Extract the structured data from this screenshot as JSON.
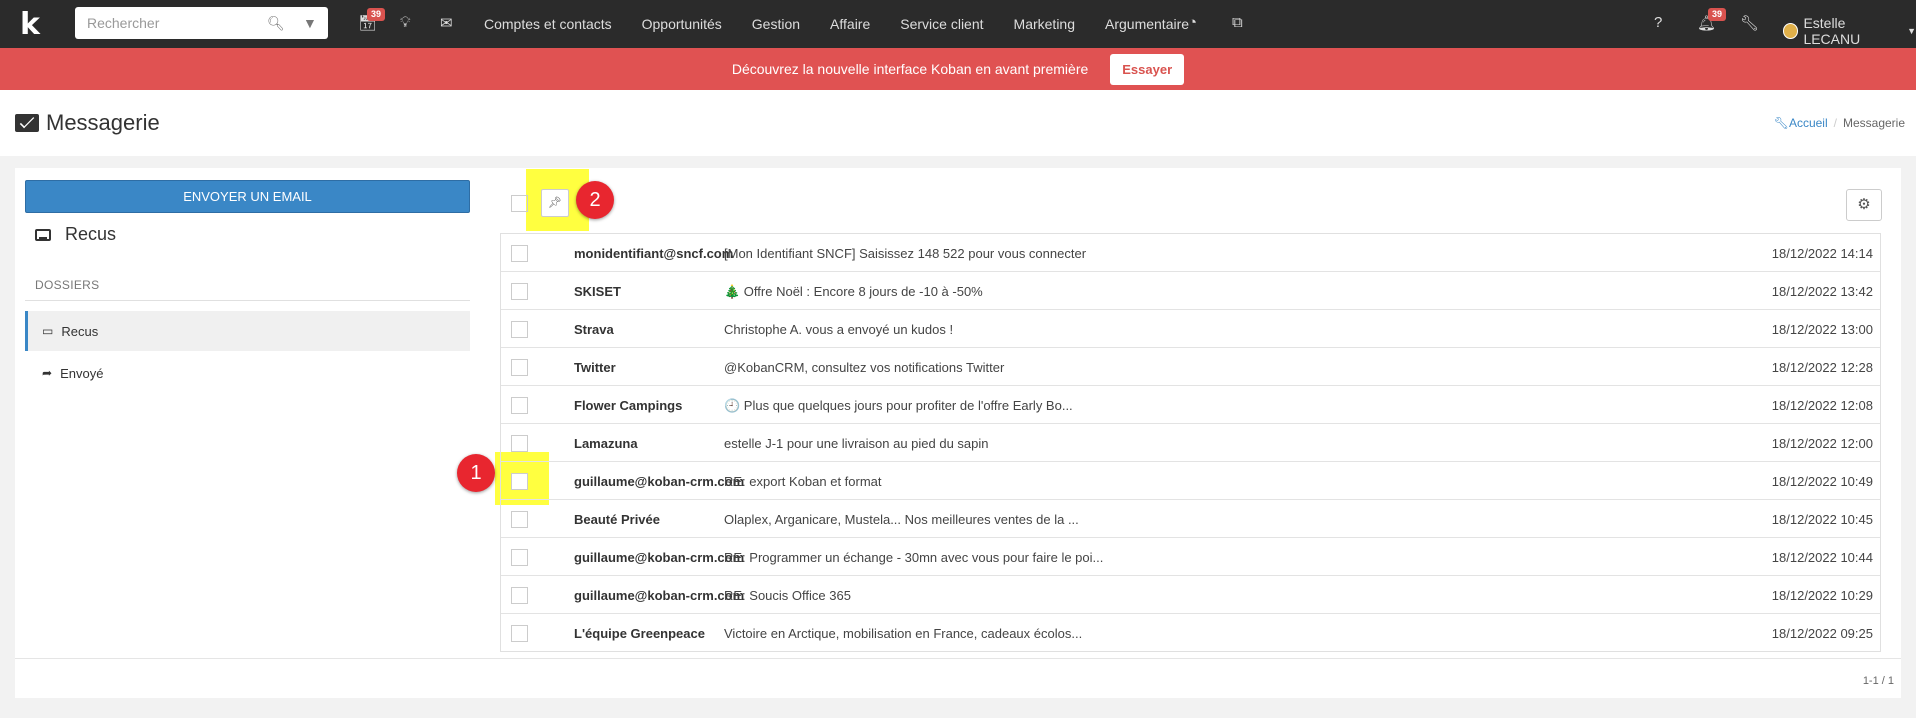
{
  "app": {
    "logo": "k"
  },
  "search": {
    "placeholder": "Rechercher"
  },
  "nav": {
    "calendar_badge": "39",
    "menu": [
      "Comptes et contacts",
      "Opportunités",
      "Gestion",
      "Affaire",
      "Service client",
      "Marketing",
      "Argumentaire"
    ],
    "notifications_badge": "39",
    "user_name": "Estelle LECANU"
  },
  "banner": {
    "text": "Découvrez la nouvelle interface Koban en avant première",
    "button": "Essayer"
  },
  "header": {
    "title": "Messagerie",
    "breadcrumb_home": "Accueil",
    "breadcrumb_current": "Messagerie"
  },
  "sidebar": {
    "send_button": "ENVOYER UN EMAIL",
    "current_folder": "Recus",
    "section_label": "DOSSIERS",
    "folders": [
      {
        "label": "Recus",
        "icon": "inbox-icon"
      },
      {
        "label": "Envoyé",
        "icon": "share-icon"
      }
    ]
  },
  "annotations": {
    "marker_1": "1",
    "marker_2": "2"
  },
  "emails": [
    {
      "from": "monidentifiant@sncf.com",
      "subject": "[Mon Identifiant SNCF] Saisissez 148 522 pour vous connecter",
      "date": "18/12/2022 14:14"
    },
    {
      "from": "SKISET",
      "subject": "🎄 Offre Noël : Encore 8 jours de -10 à -50%",
      "date": "18/12/2022 13:42"
    },
    {
      "from": "Strava",
      "subject": "Christophe A. vous a envoyé un kudos !",
      "date": "18/12/2022 13:00"
    },
    {
      "from": "Twitter",
      "subject": "@KobanCRM, consultez vos notifications Twitter",
      "date": "18/12/2022 12:28"
    },
    {
      "from": "Flower Campings",
      "subject": "🕘 Plus que quelques jours pour profiter de l'offre Early Bo...",
      "date": "18/12/2022 12:08"
    },
    {
      "from": "Lamazuna",
      "subject": "estelle J-1 pour une livraison au pied du sapin",
      "date": "18/12/2022 12:00"
    },
    {
      "from": "guillaume@koban-crm.com",
      "subject": "RE: export Koban et format",
      "date": "18/12/2022 10:49"
    },
    {
      "from": "Beauté Privée",
      "subject": "Olaplex, Arganicare, Mustela... Nos meilleures ventes de la ...",
      "date": "18/12/2022 10:45"
    },
    {
      "from": "guillaume@koban-crm.com",
      "subject": "RE: Programmer un échange - 30mn avec vous pour faire le poi...",
      "date": "18/12/2022 10:44"
    },
    {
      "from": "guillaume@koban-crm.com",
      "subject": "RE: Soucis Office 365",
      "date": "18/12/2022 10:29"
    },
    {
      "from": "L'équipe Greenpeace",
      "subject": "Victoire en Arctique, mobilisation en France, cadeaux écolos...",
      "date": "18/12/2022 09:25"
    }
  ],
  "pager": "1-1 / 1"
}
